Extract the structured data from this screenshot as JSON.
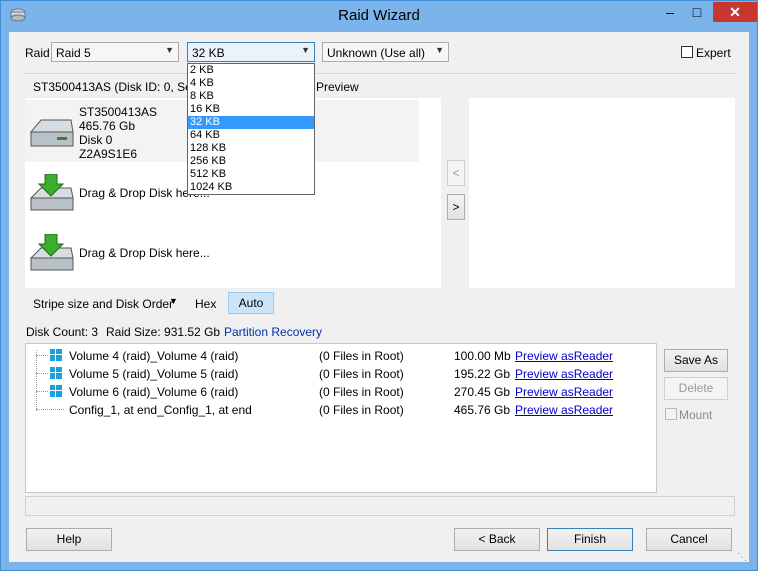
{
  "window": {
    "title": "Raid Wizard",
    "minimize": "–",
    "maximize": "□",
    "close": "✕"
  },
  "top_bar": {
    "raid_label": "Raid",
    "raid_value": "Raid 5",
    "stripe_value": "32 KB",
    "order_value": "Unknown (Use all)",
    "expert_label": "Expert",
    "expert_checked": false
  },
  "stripe_dropdown": {
    "options": [
      "2 KB",
      "4 KB",
      "8 KB",
      "16 KB",
      "32 KB",
      "64 KB",
      "128 KB",
      "256 KB",
      "512 KB",
      "1024 KB"
    ],
    "selected": "32 KB"
  },
  "disk_header": {
    "text": "ST3500413AS (Disk ID: 0, Seria",
    "preview_tab": "Preview"
  },
  "disks": [
    {
      "model": "ST3500413AS",
      "size": "465.76 Gb",
      "disk": "Disk 0",
      "serial": "Z2A9S1E6"
    }
  ],
  "drop_targets": [
    {
      "label": "Drag & Drop Disk here..."
    },
    {
      "label": "Drag & Drop Disk here..."
    }
  ],
  "nav_arrows": {
    "left": "<",
    "right": ">"
  },
  "toolbar": {
    "stripe_order": "Stripe size and Disk Order",
    "hex": "Hex",
    "auto": "Auto"
  },
  "info": {
    "disk_count": "Disk Count: 3",
    "raid_size": "Raid Size: 931.52 Gb",
    "partition_recovery": "Partition Recovery"
  },
  "volumes": [
    {
      "name": "Volume 4 (raid)_Volume 4 (raid)",
      "files": "(0 Files in Root)",
      "size": "100.00 Mb",
      "link": "Preview asReader",
      "icon": "windows-icon"
    },
    {
      "name": "Volume 5 (raid)_Volume 5 (raid)",
      "files": "(0 Files in Root)",
      "size": "195.22 Gb",
      "link": "Preview asReader",
      "icon": "windows-icon"
    },
    {
      "name": "Volume 6 (raid)_Volume 6 (raid)",
      "files": "(0 Files in Root)",
      "size": "270.45 Gb",
      "link": "Preview asReader",
      "icon": "windows-icon"
    },
    {
      "name": "Config_1, at end_Config_1, at end",
      "files": "(0 Files in Root)",
      "size": "465.76 Gb",
      "link": "Preview asReader",
      "icon": ""
    }
  ],
  "side_buttons": {
    "save_as": "Save As",
    "delete": "Delete",
    "mount": "Mount"
  },
  "bottom_buttons": {
    "help": "Help",
    "back": "< Back",
    "finish": "Finish",
    "cancel": "Cancel"
  },
  "colors": {
    "title_bar": "#7ab4ea",
    "close_button": "#c7372f",
    "selection": "#3399ff",
    "link": "#0000cc",
    "auto_toggle": "#cce4f7"
  }
}
